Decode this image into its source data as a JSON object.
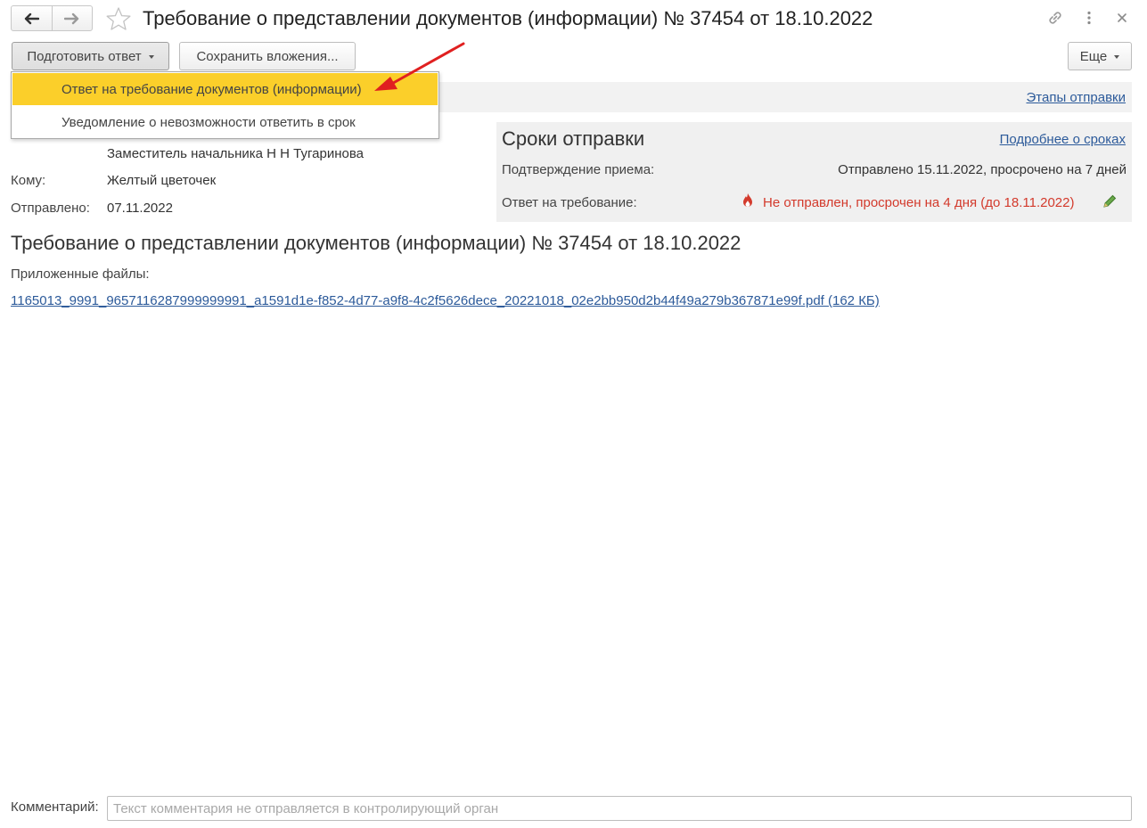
{
  "header": {
    "title": "Требование о представлении документов (информации) № 37454 от 18.10.2022",
    "icons": [
      "back-arrow-icon",
      "forward-arrow-icon",
      "star-icon",
      "link-icon",
      "more-icon",
      "close-icon"
    ]
  },
  "toolbar": {
    "prepare_label": "Подготовить ответ",
    "save_attachments_label": "Сохранить вложения...",
    "more_label": "Еще"
  },
  "dropdown": {
    "items": [
      {
        "label": "Ответ на требование документов (информации)",
        "selected": true
      },
      {
        "label": "Уведомление о невозможности ответить в срок",
        "selected": false
      }
    ]
  },
  "band": {
    "link": "Этапы отправки"
  },
  "details": {
    "from_value": "Заместитель начальника Н Н Тугаринова",
    "to_label": "Кому:",
    "to_value": "Желтый цветочек",
    "sent_label": "Отправлено:",
    "sent_value": "07.11.2022"
  },
  "deadlines": {
    "title": "Сроки отправки",
    "more_link": "Подробнее о сроках",
    "receipt_label": "Подтверждение приема:",
    "receipt_value": "Отправлено 15.11.2022, просрочено на 7 дней",
    "reply_label": "Ответ на требование:",
    "reply_value": "Не отправлен, просрочен на 4 дня (до 18.11.2022)",
    "reply_status_color": "#d33a2c"
  },
  "document": {
    "heading": "Требование о представлении документов (информации) № 37454 от 18.10.2022",
    "files_label": "Приложенные файлы:",
    "file_link": "1165013_9991_9657116287999999991_a1591d1e-f852-4d77-a9f8-4c2f5626dece_20221018_02e2bb950d2b44f49a279b367871e99f.pdf (162 КБ)"
  },
  "comment": {
    "label": "Комментарий:",
    "placeholder": "Текст комментария не отправляется в контролирующий орган",
    "value": ""
  },
  "colors": {
    "accent_yellow": "#fbcf2a",
    "link_blue": "#2c5a9a",
    "alert_red": "#d33a2c",
    "annotation_arrow": "#e02020",
    "edit_icon_green": "#5a9a3a"
  }
}
